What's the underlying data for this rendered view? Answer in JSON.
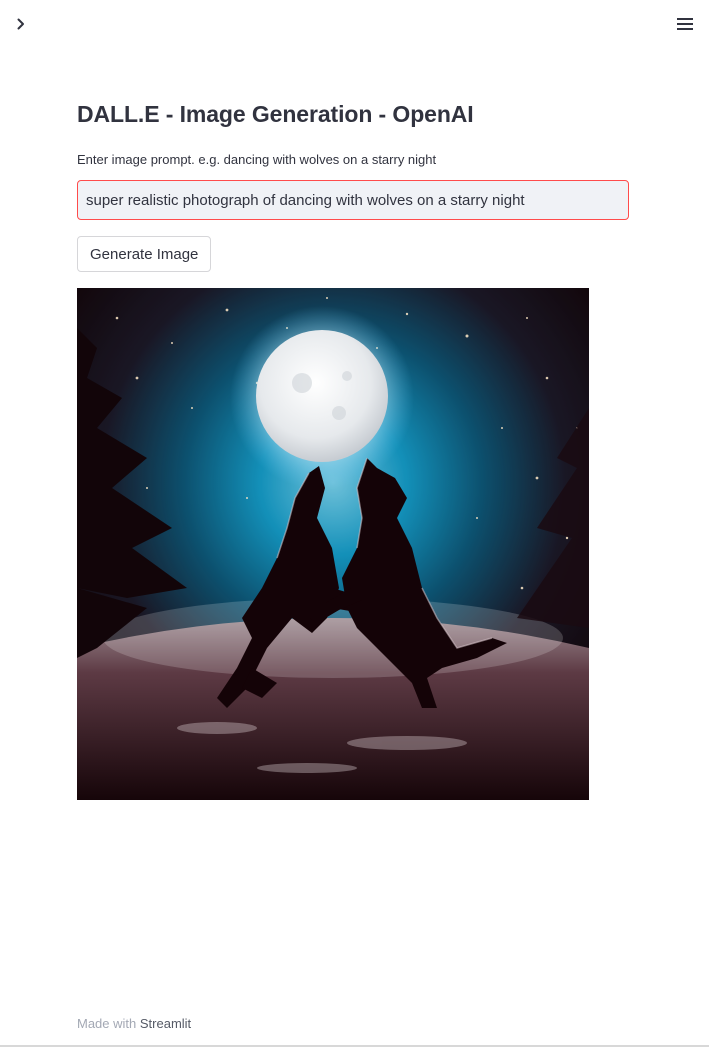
{
  "header": {
    "sidebar_toggle_icon": "chevron-right-icon",
    "menu_icon": "hamburger-menu-icon"
  },
  "main": {
    "title": "DALL.E - Image Generation - OpenAI",
    "prompt_label": "Enter image prompt. e.g. dancing with wolves on a starry night",
    "prompt_value": "super realistic photograph of dancing with wolves on a starry night",
    "generate_button_label": "Generate Image",
    "generated_image_subject": "two wolves dancing under a full moon on a starry night"
  },
  "footer": {
    "prefix": "Made with ",
    "brand": "Streamlit"
  },
  "colors": {
    "accent": "#ff4b4b",
    "text": "#31333f",
    "input_background": "#f0f2f6"
  }
}
